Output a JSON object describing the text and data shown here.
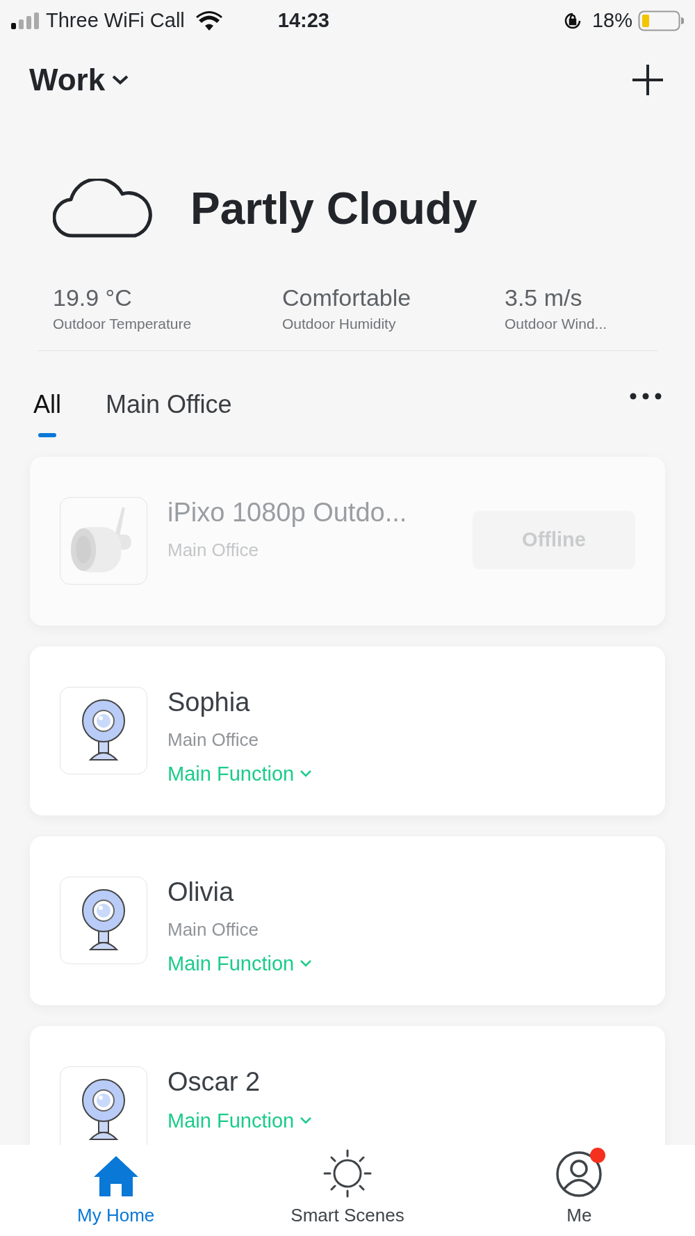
{
  "status_bar": {
    "carrier": "Three WiFi Call",
    "time": "14:23",
    "battery": "18%"
  },
  "header": {
    "home": "Work"
  },
  "weather": {
    "condition": "Partly Cloudy",
    "stats": [
      {
        "value": "19.9 °C",
        "label": "Outdoor Temperature"
      },
      {
        "value": "Comfortable",
        "label": "Outdoor Humidity"
      },
      {
        "value": "3.5 m/s",
        "label": "Outdoor Wind..."
      }
    ]
  },
  "tabs": [
    {
      "label": "All",
      "selected": true
    },
    {
      "label": "Main Office",
      "selected": false
    }
  ],
  "devices": [
    {
      "name": "iPixo 1080p Outdo...",
      "room": "Main Office",
      "online": false,
      "status": "Offline"
    },
    {
      "kind": "webcam",
      "name": "Sophia",
      "room": "Main Office",
      "online": true,
      "function": "Main Function"
    },
    {
      "kind": "webcam",
      "name": "Olivia",
      "room": "Main Office",
      "online": true,
      "function": "Main Function"
    },
    {
      "kind": "webcam",
      "name": "Oscar 2",
      "online": true,
      "function": "Main Function"
    }
  ],
  "nav": [
    {
      "label": "My Home",
      "kind": "home",
      "selected": true,
      "badge": false
    },
    {
      "label": "Smart Scenes",
      "kind": "scenes",
      "selected": false,
      "badge": false
    },
    {
      "label": "Me",
      "kind": "me",
      "selected": false,
      "badge": true
    }
  ]
}
